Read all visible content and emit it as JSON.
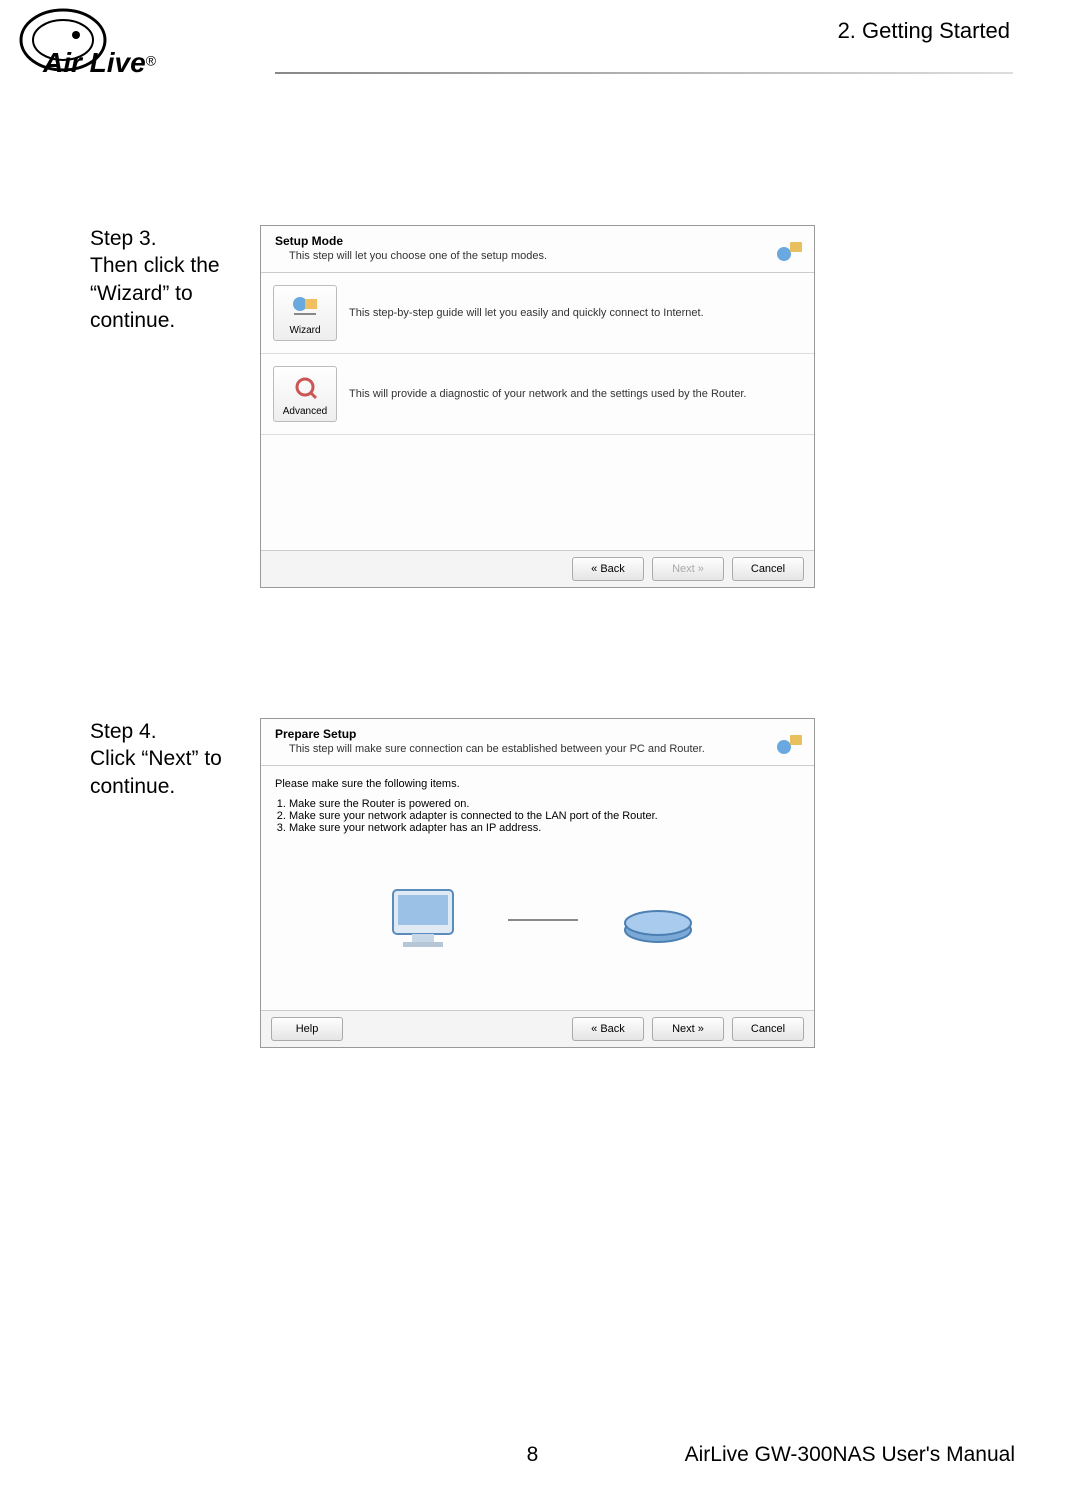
{
  "page": {
    "chapter_title": "2.  Getting  Started",
    "number": "8",
    "manual_ref": "AirLive GW-300NAS User's Manual",
    "logo_text": "Air Live",
    "logo_r": "®"
  },
  "step3": {
    "label": "Step 3.",
    "text": "Then click the “Wizard” to continue."
  },
  "step4": {
    "label": "Step 4.",
    "text": "Click “Next” to continue."
  },
  "screenshot1": {
    "title": "Setup Mode",
    "subtitle": "This step will let you choose one of the setup modes.",
    "wizard_label": "Wizard",
    "wizard_desc": "This step-by-step guide will let you easily and quickly connect to Internet.",
    "advanced_label": "Advanced",
    "advanced_desc": "This will provide a diagnostic of your network and the settings used by the Router.",
    "back": "« Back",
    "next": "Next »",
    "cancel": "Cancel"
  },
  "screenshot2": {
    "title": "Prepare Setup",
    "subtitle": "This step will make sure connection can be established between your PC and Router.",
    "lead": "Please make sure the following items.",
    "item1": "Make sure the Router is powered on.",
    "item2": "Make sure your network adapter is connected to the LAN port of the Router.",
    "item3": "Make sure your network adapter has an IP address.",
    "help": "Help",
    "back": "« Back",
    "next": "Next »",
    "cancel": "Cancel"
  }
}
